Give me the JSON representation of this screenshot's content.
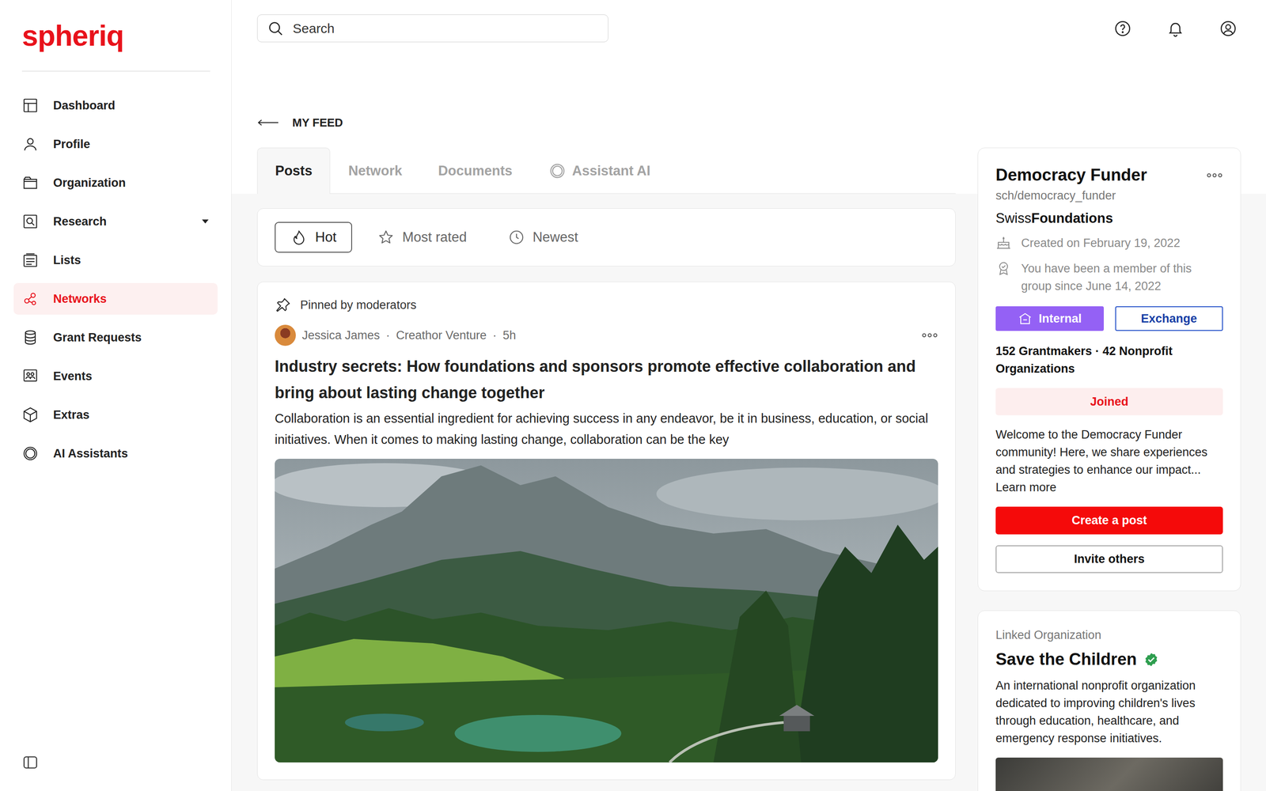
{
  "logo": "spheriq",
  "sidebar": {
    "items": [
      {
        "label": "Dashboard",
        "selected": false,
        "has_submenu": false
      },
      {
        "label": "Profile",
        "selected": false,
        "has_submenu": false
      },
      {
        "label": "Organization",
        "selected": false,
        "has_submenu": false
      },
      {
        "label": "Research",
        "selected": false,
        "has_submenu": true
      },
      {
        "label": "Lists",
        "selected": false,
        "has_submenu": false
      },
      {
        "label": "Networks",
        "selected": true,
        "has_submenu": false
      },
      {
        "label": "Grant Requests",
        "selected": false,
        "has_submenu": false
      },
      {
        "label": "Events",
        "selected": false,
        "has_submenu": false
      },
      {
        "label": "Extras",
        "selected": false,
        "has_submenu": false
      },
      {
        "label": "AI Assistants",
        "selected": false,
        "has_submenu": false
      }
    ]
  },
  "search": {
    "placeholder": "Search"
  },
  "back_link": {
    "label": "MY FEED"
  },
  "tabs": [
    {
      "label": "Posts",
      "selected": true,
      "kind": "plain"
    },
    {
      "label": "Network",
      "selected": false,
      "kind": "plain"
    },
    {
      "label": "Documents",
      "selected": false,
      "kind": "plain"
    },
    {
      "label": "Assistant AI",
      "selected": false,
      "kind": "ai"
    }
  ],
  "sort_options": [
    {
      "label": "Hot",
      "selected": true
    },
    {
      "label": "Most rated",
      "selected": false
    },
    {
      "label": "Newest",
      "selected": false
    }
  ],
  "posts": [
    {
      "pinned": true,
      "pinned_label": "Pinned by moderators",
      "author": "Jessica James",
      "organization": "Creathor Venture",
      "time": "5h",
      "separator": "·",
      "title": "Industry secrets: How foundations and sponsors promote effective collaboration and bring about lasting change together",
      "excerpt": "Collaboration is an essential ingredient for achieving success in any endeavor, be it in business, education, or social initiatives. When it comes to making lasting change, collaboration can be the key"
    }
  ],
  "group": {
    "name": "Democracy Funder",
    "handle": "sch/democracy_funder",
    "brand": {
      "light": "Swiss",
      "bold": "Foundations"
    },
    "created": "Created on February 19, 2022",
    "membership": "You have been a member of this group since June 14, 2022",
    "badges": [
      {
        "label": "Internal",
        "kind": "filled"
      },
      {
        "label": "Exchange",
        "kind": "outline"
      }
    ],
    "stats": "152 Grantmakers · 42 Nonprofit Organizations",
    "joined": true,
    "join_label": "Joined",
    "description": "Welcome to the Democracy Funder community! Here, we share experiences and strategies to enhance our impact...",
    "learn_more": "Learn more",
    "actions": [
      {
        "label": "Create a post",
        "kind": "primary"
      },
      {
        "label": "Invite others",
        "kind": "outline"
      }
    ]
  },
  "linked_organization": {
    "caption": "Linked Organization",
    "name": "Save the Children",
    "verified": true,
    "description": "An international nonprofit organization dedicated to improving children's lives through education, healthcare, and emergency response initiatives."
  }
}
